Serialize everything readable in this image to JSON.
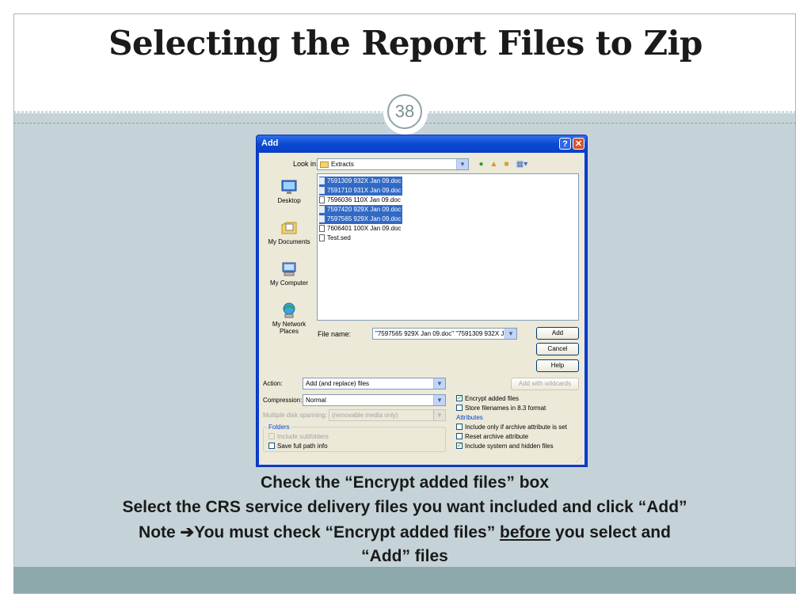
{
  "slide": {
    "title": "Selecting the Report Files to Zip",
    "page_number": "38",
    "colors": {
      "frame_bg": "#c5d3d8",
      "band": "#8ea9ab",
      "accent": "#8ea3a8"
    }
  },
  "dialog": {
    "title": "Add",
    "help_button": "?",
    "close_button": "✕",
    "look_in_label": "Look in:",
    "look_in_value": "Extracts",
    "places": [
      {
        "label": "Desktop",
        "icon": "desktop-icon"
      },
      {
        "label": "My Documents",
        "icon": "my-documents-icon"
      },
      {
        "label": "My Computer",
        "icon": "my-computer-icon"
      },
      {
        "label": "My Network Places",
        "icon": "network-places-icon"
      }
    ],
    "files": [
      {
        "name": "7591309 932X Jan 09.doc",
        "selected": true
      },
      {
        "name": "7591710 931X Jan 09.doc",
        "selected": true
      },
      {
        "name": "7596036 110X Jan 09.doc",
        "selected": false
      },
      {
        "name": "7597420 929X Jan 09.doc",
        "selected": true
      },
      {
        "name": "7597565 929X Jan 09.doc",
        "selected": true
      },
      {
        "name": "7606401 100X Jan 09.doc",
        "selected": false
      },
      {
        "name": "Test.sed",
        "selected": false
      }
    ],
    "file_name_label": "File name:",
    "file_name_value": "\"7597565 929X Jan 09.doc\" \"7591309 932X J",
    "add_button": "Add",
    "cancel_button": "Cancel",
    "help_btn": "Help",
    "action_label": "Action:",
    "action_value": "Add (and replace) files",
    "compression_label": "Compression:",
    "compression_value": "Normal",
    "multiple_disk_label": "Multiple disk spanning:",
    "multiple_disk_value": "(removable media only)",
    "add_with_wildcards": "Add with wildcards",
    "folders_title": "Folders",
    "include_subfolders": "Include subfolders",
    "save_full_path": "Save full path info",
    "encrypt_added_files": "Encrypt added files",
    "store_filenames": "Store filenames in 8.3 format",
    "attributes_title": "Attributes",
    "include_archive": "Include only if archive attribute is set",
    "reset_archive": "Reset archive attribute",
    "include_system": "Include system and hidden files",
    "checked": {
      "encrypt": true,
      "store": false,
      "include_archive": false,
      "reset_archive": false,
      "include_system": true,
      "include_subfolders": false,
      "save_full_path": false
    }
  },
  "caption": {
    "line1": "Check the “Encrypt added files” box",
    "line2": "Select the CRS service delivery files you want included and click “Add”",
    "line3_prefix": "Note ",
    "line3_arrow": "➔",
    "line3_mid": "You must check “Encrypt added files” ",
    "line3_underlined": "before",
    "line3_suffix": " you select and",
    "line4": "“Add” files"
  }
}
